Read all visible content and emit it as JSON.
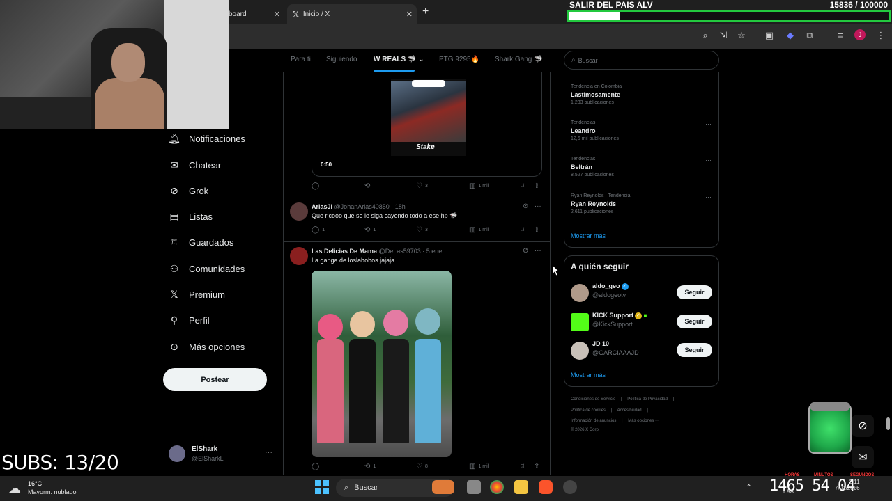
{
  "browser": {
    "tabs": [
      {
        "label": "board",
        "active": false
      },
      {
        "label": "Inicio / X",
        "active": true
      }
    ],
    "new_tab": "+",
    "close": "✕",
    "profile_initial": "J"
  },
  "goal": {
    "title": "SALIR DEL PAIS ALV",
    "count": "15836  / 100000",
    "progress": 0.158,
    "bar_color": "#23c93f"
  },
  "sidebar": {
    "items": [
      {
        "label": "Notificaciones",
        "icon": "bell-icon"
      },
      {
        "label": "Chatear",
        "icon": "mail-icon"
      },
      {
        "label": "Grok",
        "icon": "grok-icon"
      },
      {
        "label": "Listas",
        "icon": "list-icon"
      },
      {
        "label": "Guardados",
        "icon": "bookmark-icon"
      },
      {
        "label": "Comunidades",
        "icon": "people-icon"
      },
      {
        "label": "Premium",
        "icon": "x-logo-icon"
      },
      {
        "label": "Perfil",
        "icon": "person-icon"
      },
      {
        "label": "Más opciones",
        "icon": "more-circle-icon"
      }
    ],
    "post_button": "Postear",
    "profile": {
      "name": "ElShark",
      "handle": "@ElSharkL",
      "more": "···"
    }
  },
  "overlay": {
    "subs": "SUBS: 13/20"
  },
  "timeline": {
    "tabs": [
      {
        "label": "Para ti",
        "active": false
      },
      {
        "label": "Siguiendo",
        "active": false
      },
      {
        "label": "W REALS 🦈",
        "active": true
      },
      {
        "label": "PTG 9295🔥",
        "active": false
      },
      {
        "label": "Shark Gang 🦈",
        "active": false
      }
    ],
    "video": {
      "time": "0:50",
      "brand": "Stake",
      "actions": {
        "replies": "",
        "reposts": "",
        "likes": "3",
        "views": "1 mil"
      }
    },
    "tweets": [
      {
        "name": "AriasJI",
        "handle": "@JohanArias40850",
        "time": "· 18h",
        "text": "Que ricooo que se le siga cayendo todo    a ese hp 🦈",
        "actions": {
          "replies": "1",
          "reposts": "1",
          "likes": "3",
          "views": "1 mil"
        }
      },
      {
        "name": "Las Delicias De Mama",
        "handle": "@DeLas59703",
        "time": "· 5 ene.",
        "text": "La ganga de loslabobos jajaja",
        "actions": {
          "replies": "",
          "reposts": "1",
          "likes": "8",
          "views": "1 mil"
        }
      }
    ]
  },
  "right": {
    "search_placeholder": "Buscar",
    "trends": [
      {
        "category": "Tendencia en Colombia",
        "name": "Lastimosamente",
        "count": "1.233 publicaciones"
      },
      {
        "category": "Tendencias",
        "name": "Leandro",
        "count": "12,6 mil publicaciones"
      },
      {
        "category": "Tendencias",
        "name": "Beltrán",
        "count": "8.527 publicaciones"
      },
      {
        "category": "Ryan Reynolds · Tendencia",
        "name": "Ryan Reynolds",
        "count": "2.611 publicaciones"
      }
    ],
    "trends_more": "Mostrar más",
    "follow_title": "A quién seguir",
    "follow": [
      {
        "name": "aldo_geo",
        "handle": "@aldogeotv",
        "button": "Seguir"
      },
      {
        "name": "KICK Support",
        "handle": "@KickSupport",
        "button": "Seguir"
      },
      {
        "name": "JD 10",
        "handle": "@GARCIAAAJD",
        "button": "Seguir"
      }
    ],
    "follow_more": "Mostrar más",
    "footer_line1": [
      "Condiciones de Servicio",
      "|",
      "Política de Privacidad",
      "|"
    ],
    "footer_line2": [
      "Política de cookies",
      "|",
      "Accesibilidad",
      "|"
    ],
    "footer_line3": [
      "Información de anuncios",
      "|",
      "Más opciones ···"
    ],
    "footer_copy": "© 2026 X Corp."
  },
  "taskbar": {
    "temp": "16°C",
    "weather": "Mayorm. nublado",
    "search": "Buscar",
    "timer": "1465 54 04",
    "timer_labels": [
      "HORAS",
      "MINUTOS",
      "SEGUNDOS"
    ],
    "lang": "LAA",
    "time": "2:11",
    "date": "7/01/2026"
  }
}
